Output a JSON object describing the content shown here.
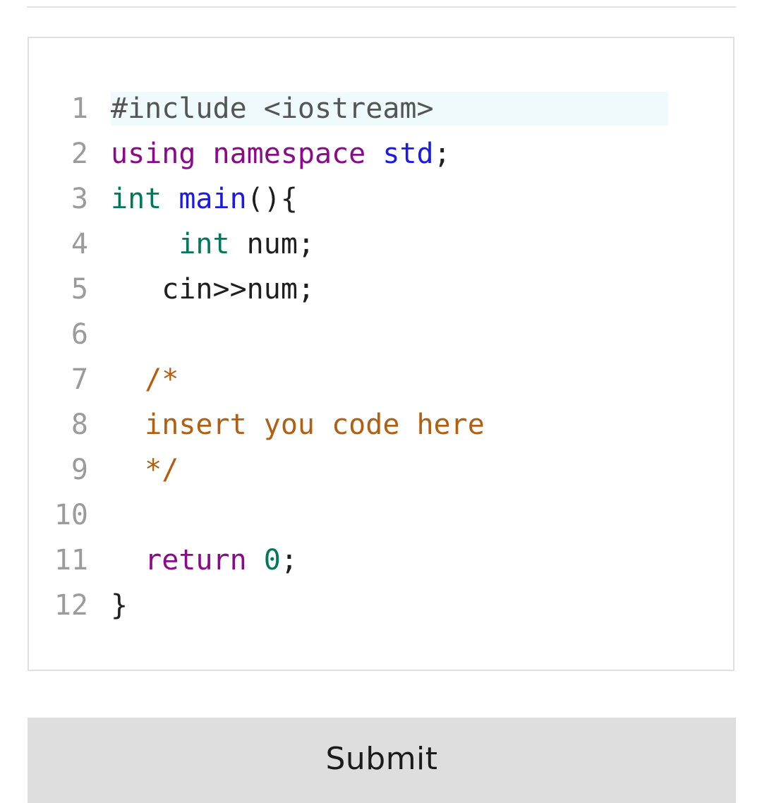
{
  "editor": {
    "language": "cpp",
    "active_line": 1,
    "colors": {
      "highlight_line_bg": "#effafc",
      "gutter_text": "#9b9b9b",
      "border": "#e0e0e0",
      "preprocessor": "#555555",
      "keyword": "#8b0a8b",
      "type": "#00785c",
      "function": "#1a1ae6",
      "namespace": "#1a1ae6",
      "comment": "#b35f12",
      "number": "#00785c",
      "plain": "#1f1f1f"
    },
    "lines": [
      {
        "number": "1",
        "tokens": [
          {
            "text": "#include ",
            "kind": "preproc"
          },
          {
            "text": "<iostream>",
            "kind": "preproc"
          }
        ]
      },
      {
        "number": "2",
        "tokens": [
          {
            "text": "using",
            "kind": "keyword"
          },
          {
            "text": " ",
            "kind": "plain"
          },
          {
            "text": "namespace",
            "kind": "keyword"
          },
          {
            "text": " ",
            "kind": "plain"
          },
          {
            "text": "std",
            "kind": "ns"
          },
          {
            "text": ";",
            "kind": "punct"
          }
        ]
      },
      {
        "number": "3",
        "tokens": [
          {
            "text": "int",
            "kind": "type"
          },
          {
            "text": " ",
            "kind": "plain"
          },
          {
            "text": "main",
            "kind": "func"
          },
          {
            "text": "(){",
            "kind": "punct"
          }
        ]
      },
      {
        "number": "4",
        "tokens": [
          {
            "text": "    ",
            "kind": "plain"
          },
          {
            "text": "int",
            "kind": "type"
          },
          {
            "text": " num;",
            "kind": "plain"
          }
        ]
      },
      {
        "number": "5",
        "tokens": [
          {
            "text": "   cin>>num;",
            "kind": "plain"
          }
        ]
      },
      {
        "number": "6",
        "tokens": []
      },
      {
        "number": "7",
        "tokens": [
          {
            "text": "  /*",
            "kind": "comment"
          }
        ]
      },
      {
        "number": "8",
        "tokens": [
          {
            "text": "  insert you code here",
            "kind": "comment"
          }
        ]
      },
      {
        "number": "9",
        "tokens": [
          {
            "text": "  */",
            "kind": "comment"
          }
        ]
      },
      {
        "number": "10",
        "tokens": []
      },
      {
        "number": "11",
        "tokens": [
          {
            "text": "  ",
            "kind": "plain"
          },
          {
            "text": "return",
            "kind": "keyword"
          },
          {
            "text": " ",
            "kind": "plain"
          },
          {
            "text": "0",
            "kind": "number"
          },
          {
            "text": ";",
            "kind": "punct"
          }
        ]
      },
      {
        "number": "12",
        "tokens": [
          {
            "text": "}",
            "kind": "punct"
          }
        ]
      }
    ]
  },
  "submit": {
    "label": "Submit",
    "background": "#dedede"
  }
}
